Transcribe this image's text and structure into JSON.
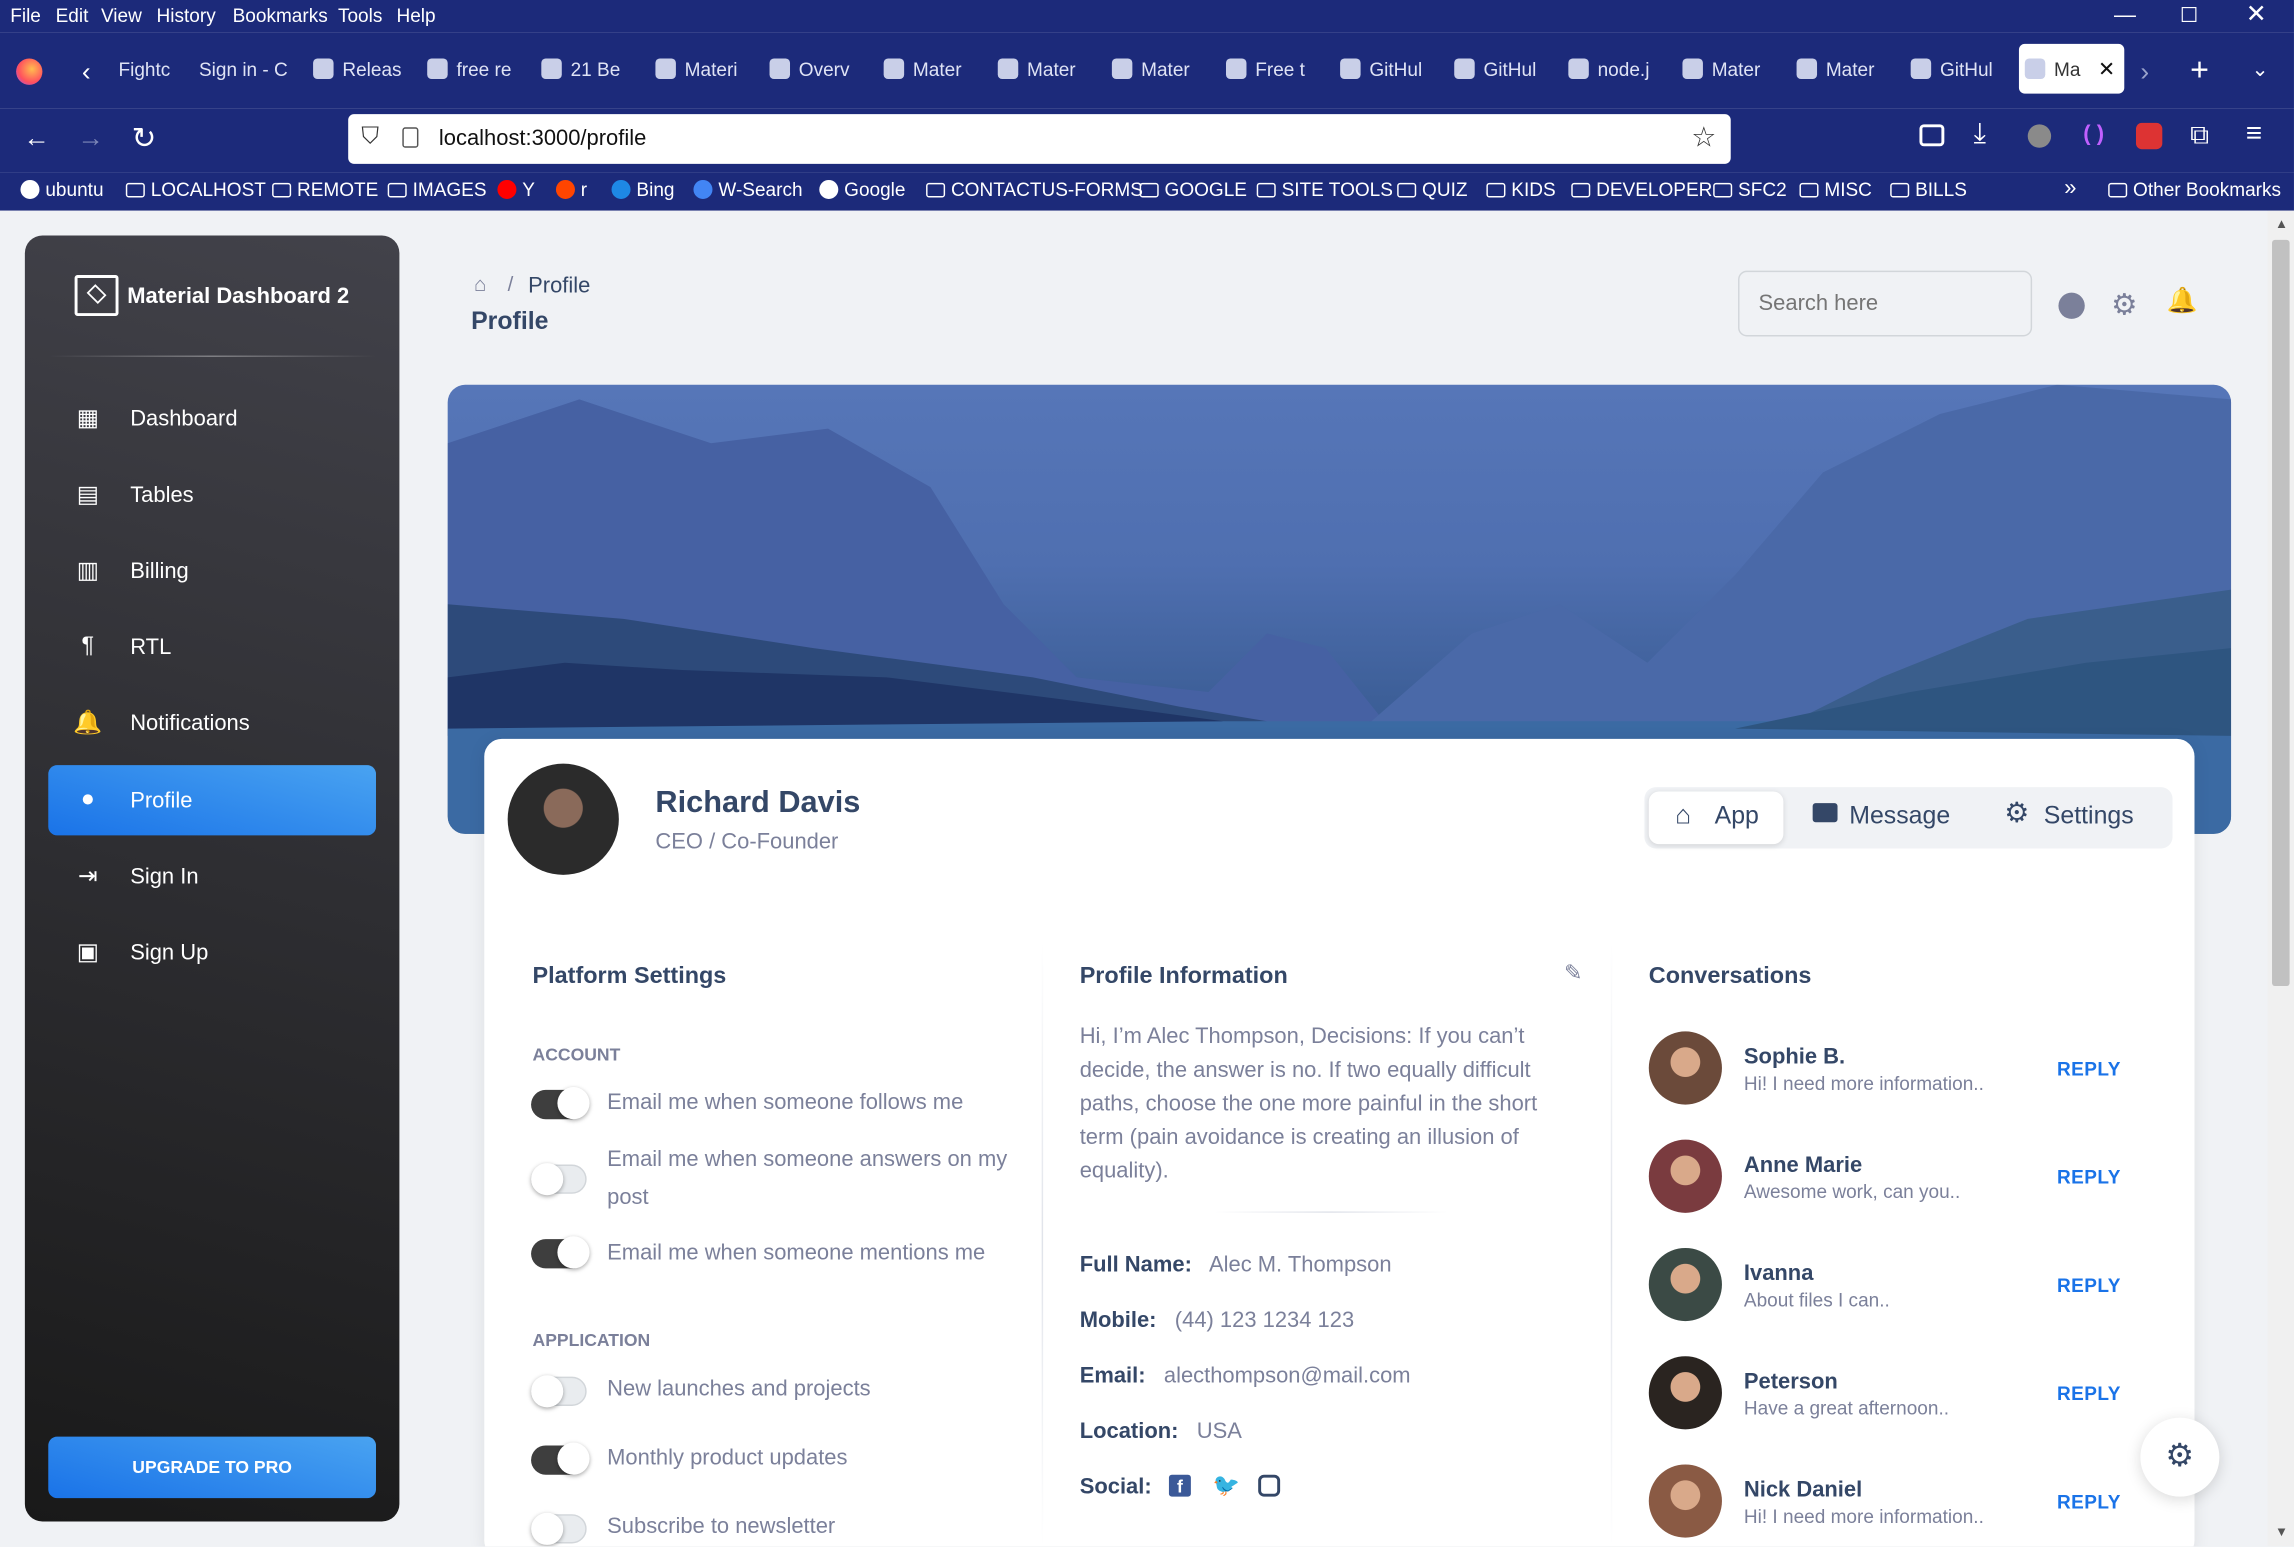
{
  "menu": [
    "File",
    "Edit",
    "View",
    "History",
    "Bookmarks",
    "Tools",
    "Help"
  ],
  "tabs": [
    {
      "label": "Fightc",
      "icon": ""
    },
    {
      "label": "Sign in - C",
      "icon": ""
    },
    {
      "label": "Releas",
      "icon": "github"
    },
    {
      "label": "free re",
      "icon": "google"
    },
    {
      "label": "21 Be",
      "icon": "colorlib"
    },
    {
      "label": "Materi",
      "icon": "md"
    },
    {
      "label": "Overv",
      "icon": "bow"
    },
    {
      "label": "Mater",
      "icon": "md"
    },
    {
      "label": "Mater",
      "icon": "bow"
    },
    {
      "label": "Mater",
      "icon": "md"
    },
    {
      "label": "Free t",
      "icon": "c"
    },
    {
      "label": "GitHul",
      "icon": "github"
    },
    {
      "label": "GitHul",
      "icon": "github"
    },
    {
      "label": "node.j",
      "icon": "so"
    },
    {
      "label": "Mater",
      "icon": "md"
    },
    {
      "label": "Mater",
      "icon": "md"
    },
    {
      "label": "GitHul",
      "icon": "github"
    },
    {
      "label": "Ma",
      "icon": "bow"
    }
  ],
  "url": "localhost:3000/profile",
  "bookmarks": [
    "ubuntu",
    "LOCALHOST",
    "REMOTE",
    "IMAGES",
    "Y",
    "r",
    "Bing",
    "W-Search",
    "Google",
    "CONTACTUS-FORMS",
    "GOOGLE",
    "SITE TOOLS",
    "QUIZ",
    "KIDS",
    "DEVELOPER",
    "SFC2",
    "MISC",
    "BILLS",
    "Other Bookmarks"
  ],
  "brand": "Material Dashboard 2",
  "sidebar": [
    {
      "label": "Dashboard",
      "icon": "dashboard-icon",
      "glyph": "▦"
    },
    {
      "label": "Tables",
      "icon": "table-icon",
      "glyph": "▤"
    },
    {
      "label": "Billing",
      "icon": "receipt-icon",
      "glyph": "▥"
    },
    {
      "label": "RTL",
      "icon": "rtl-icon",
      "glyph": "¶"
    },
    {
      "label": "Notifications",
      "icon": "bell-icon",
      "glyph": "🔔"
    },
    {
      "label": "Profile",
      "icon": "person-icon",
      "glyph": "●"
    },
    {
      "label": "Sign In",
      "icon": "login-icon",
      "glyph": "⇥"
    },
    {
      "label": "Sign Up",
      "icon": "assignment-icon",
      "glyph": "▣"
    }
  ],
  "upgrade": "UPGRADE TO PRO",
  "breadcrumb": {
    "sep": "/",
    "current": "Profile"
  },
  "page_title": "Profile",
  "search_placeholder": "Search here",
  "profile": {
    "name": "Richard Davis",
    "role": "CEO / Co-Founder"
  },
  "tabs_nav": [
    "App",
    "Message",
    "Settings"
  ],
  "platform": {
    "title": "Platform Settings",
    "account_head": "ACCOUNT",
    "application_head": "APPLICATION",
    "account": [
      {
        "label": "Email me when someone follows me",
        "on": true
      },
      {
        "label": "Email me when someone answers on my post",
        "on": false
      },
      {
        "label": "Email me when someone mentions me",
        "on": true
      }
    ],
    "application": [
      {
        "label": "New launches and projects",
        "on": false
      },
      {
        "label": "Monthly product updates",
        "on": true
      },
      {
        "label": "Subscribe to newsletter",
        "on": false
      }
    ]
  },
  "info": {
    "title": "Profile Information",
    "bio": "Hi, I’m Alec Thompson, Decisions: If you can’t decide, the answer is no. If two equally difficult paths, choose the one more painful in the short term (pain avoidance is creating an illusion of equality).",
    "full_name_label": "Full Name:",
    "full_name": "Alec M. Thompson",
    "mobile_label": "Mobile:",
    "mobile": "(44) 123 1234 123",
    "email_label": "Email:",
    "email": "alecthompson@mail.com",
    "location_label": "Location:",
    "location": "USA",
    "social_label": "Social:"
  },
  "conversations": {
    "title": "Conversations",
    "reply": "REPLY",
    "items": [
      {
        "name": "Sophie B.",
        "msg": "Hi! I need more information..",
        "color": "#6b4a3a"
      },
      {
        "name": "Anne Marie",
        "msg": "Awesome work, can you..",
        "color": "#7a3b3f"
      },
      {
        "name": "Ivanna",
        "msg": "About files I can..",
        "color": "#3b4a45"
      },
      {
        "name": "Peterson",
        "msg": "Have a great afternoon..",
        "color": "#2a2420"
      },
      {
        "name": "Nick Daniel",
        "msg": "Hi! I need more information..",
        "color": "#8a5a44"
      }
    ]
  }
}
